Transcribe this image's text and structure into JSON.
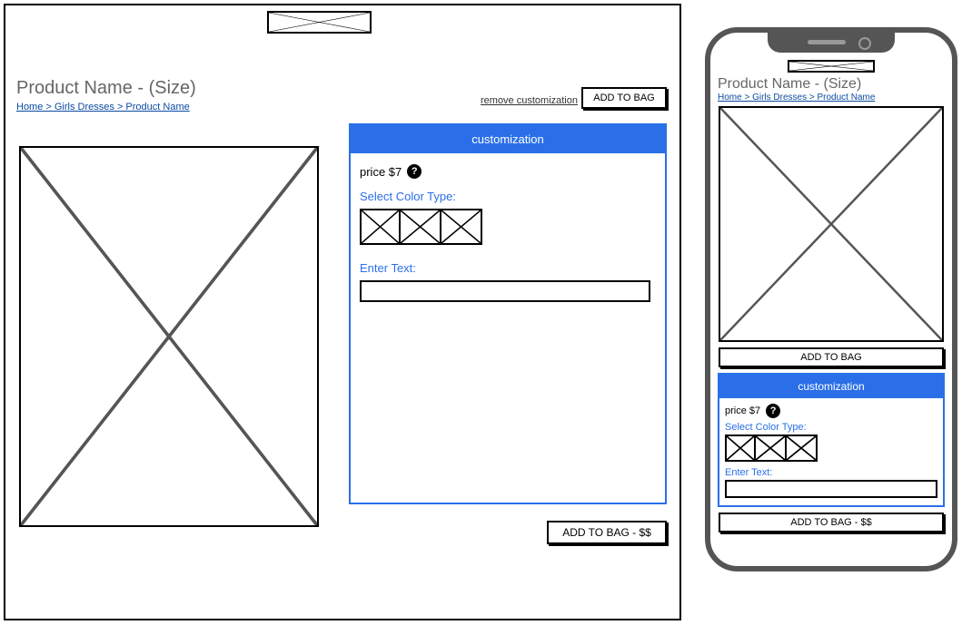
{
  "desktop": {
    "title": "Product Name - (Size)",
    "breadcrumb": "Home > Girls Dresses > Product Name",
    "remove_label": "remove customization",
    "add_to_bag_top": "ADD TO BAG",
    "add_to_bag_bottom": "ADD TO BAG - $$",
    "customization": {
      "header": "customization",
      "price_label": "price $7",
      "select_color_label": "Select Color Type:",
      "enter_text_label": "Enter Text:"
    }
  },
  "mobile": {
    "title": "Product Name - (Size)",
    "breadcrumb": "Home > Girls Dresses > Product Name",
    "add_to_bag_top": "ADD TO BAG",
    "add_to_bag_bottom": "ADD TO BAG - $$",
    "customization": {
      "header": "customization",
      "price_label": "price $7",
      "select_color_label": "Select Color Type:",
      "enter_text_label": "Enter Text:"
    }
  }
}
